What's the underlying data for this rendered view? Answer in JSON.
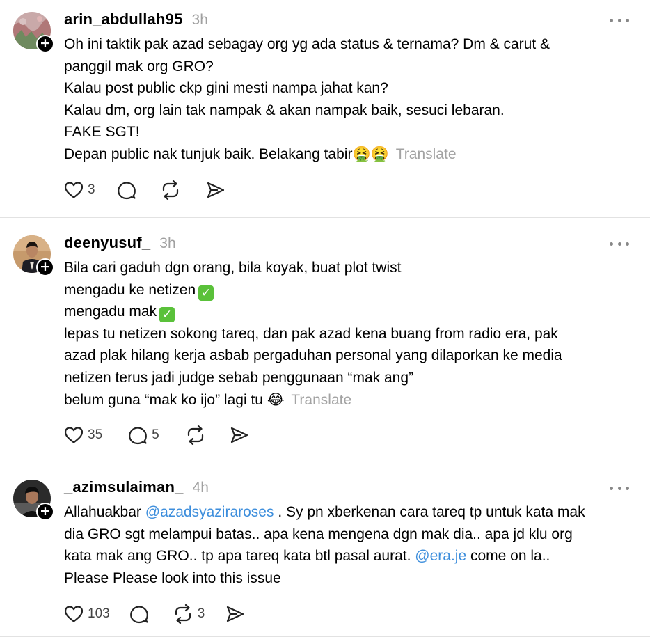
{
  "posts": [
    {
      "username": "arin_abdullah95",
      "time": "3h",
      "lines": [
        "Oh ini taktik pak azad sebagay org yg ada status & ternama? Dm & carut &",
        "panggil mak org GRO?",
        "Kalau post public ckp gini mesti nampa jahat kan?",
        "Kalau dm, org lain tak nampak & akan nampak baik, sesuci lebaran.",
        "FAKE SGT!",
        "Depan public nak tunjuk baik. Belakang tabir"
      ],
      "last_emoji": "🤮🤮",
      "translate": "Translate",
      "likes": "3",
      "replies": "",
      "reposts": ""
    },
    {
      "username": "deenyusuf_",
      "time": "3h",
      "lines": [
        "Bila cari gaduh dgn orang, bila koyak, buat plot twist",
        "mengadu ke netizen",
        "mengadu mak",
        "lepas tu netizen sokong tareq, dan pak azad kena buang from radio era, pak",
        "azad plak hilang kerja asbab pergaduhan personal yang dilaporkan ke media",
        "netizen terus jadi judge sebab penggunaan “mak ang”",
        "belum guna “mak ko ijo” lagi tu"
      ],
      "check_mark": "✓",
      "last_emoji": "😂",
      "translate": "Translate",
      "likes": "35",
      "replies": "5",
      "reposts": ""
    },
    {
      "username": "_azimsulaiman_",
      "time": "4h",
      "line1_pre": "Allahuakbar ",
      "mention1": "@azadsyaziraroses",
      "line1_post": " . Sy pn xberkenan cara tareq tp untuk kata mak",
      "line2": "dia GRO sgt melampui batas.. apa kena mengena dgn mak dia.. apa jd klu org",
      "line3_pre": "kata mak ang GRO.. tp apa tareq kata btl pasal aurat. ",
      "mention2": "@era.je",
      "line3_post": " come on la..",
      "line4": "Please Please look into this issue",
      "likes": "103",
      "replies": "",
      "reposts": "3"
    }
  ],
  "icons": [
    "heart-icon",
    "comment-icon",
    "repost-icon",
    "share-icon",
    "more-icon",
    "follow-plus-icon"
  ]
}
